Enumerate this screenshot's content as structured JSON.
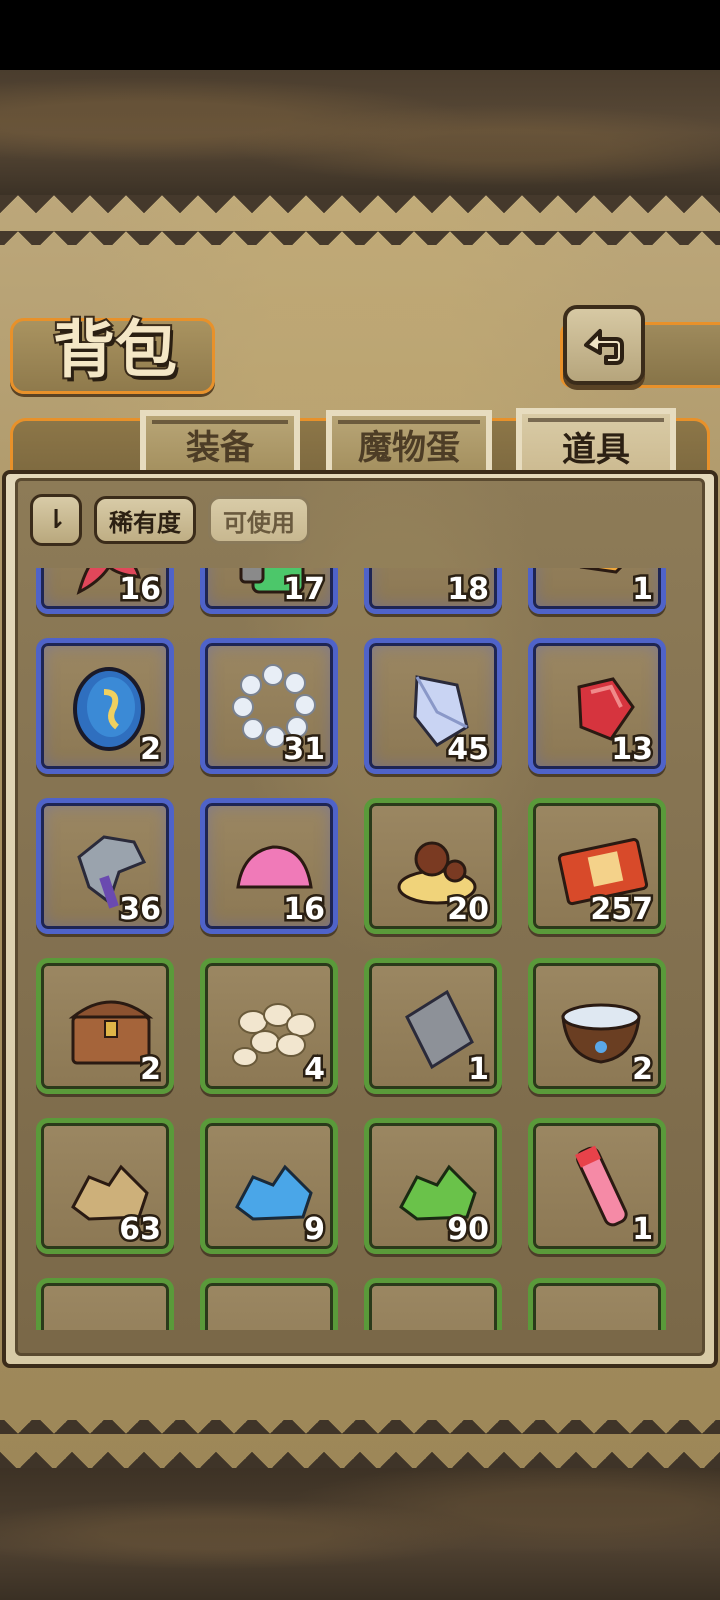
{
  "header": {
    "title": "背包",
    "back_icon": "back-arrow-icon"
  },
  "tabs": [
    {
      "label": "装备",
      "active": false
    },
    {
      "label": "魔物蛋",
      "active": false
    },
    {
      "label": "道具",
      "active": true
    }
  ],
  "filters": {
    "sort_icon": "sort-toggle-icon",
    "sort_label": "⇂",
    "chips": [
      {
        "label": "稀有度",
        "active": true
      },
      {
        "label": "可使用",
        "active": false
      }
    ]
  },
  "colors": {
    "rare_border": "#4f63c9",
    "common_border": "#5a9a3a",
    "accent_orange": "#e8912a"
  },
  "items": [
    {
      "name": "red-coral",
      "icon": "coral-icon",
      "count": "16",
      "rarity": "rare"
    },
    {
      "name": "green-battery",
      "icon": "battery-icon",
      "count": "17",
      "rarity": "rare"
    },
    {
      "name": "pink-orb",
      "icon": "pink-orb-icon",
      "count": "18",
      "rarity": "rare"
    },
    {
      "name": "gold-ore",
      "icon": "gold-ore-icon",
      "count": "1",
      "rarity": "rare"
    },
    {
      "name": "rune-coin",
      "icon": "coin-icon",
      "count": "2",
      "rarity": "rare"
    },
    {
      "name": "pearl-necklace",
      "icon": "pearl-ring-icon",
      "count": "31",
      "rarity": "rare"
    },
    {
      "name": "crystal-shard",
      "icon": "crystal-icon",
      "count": "45",
      "rarity": "rare"
    },
    {
      "name": "ruby-gem",
      "icon": "ruby-icon",
      "count": "13",
      "rarity": "rare"
    },
    {
      "name": "armor-scrap",
      "icon": "armor-scrap-icon",
      "count": "36",
      "rarity": "rare"
    },
    {
      "name": "pink-slime",
      "icon": "slime-icon",
      "count": "16",
      "rarity": "rare"
    },
    {
      "name": "pudding",
      "icon": "pudding-icon",
      "count": "20",
      "rarity": "common"
    },
    {
      "name": "ticket",
      "icon": "ticket-icon",
      "count": "257",
      "rarity": "common"
    },
    {
      "name": "treasure-chest",
      "icon": "chest-icon",
      "count": "2",
      "rarity": "common"
    },
    {
      "name": "eggs",
      "icon": "eggs-icon",
      "count": "4",
      "rarity": "common"
    },
    {
      "name": "iron-bar",
      "icon": "iron-bar-icon",
      "count": "1",
      "rarity": "common"
    },
    {
      "name": "water-bowl",
      "icon": "bowl-icon",
      "count": "2",
      "rarity": "common"
    },
    {
      "name": "sand-ore",
      "icon": "sand-ore-icon",
      "count": "63",
      "rarity": "common"
    },
    {
      "name": "blue-ore",
      "icon": "blue-ore-icon",
      "count": "9",
      "rarity": "common"
    },
    {
      "name": "green-ore",
      "icon": "green-ore-icon",
      "count": "90",
      "rarity": "common"
    },
    {
      "name": "potion-vial",
      "icon": "potion-icon",
      "count": "1",
      "rarity": "common"
    },
    {
      "name": "partial-1",
      "icon": "",
      "count": "",
      "rarity": "common"
    },
    {
      "name": "partial-2",
      "icon": "",
      "count": "",
      "rarity": "common"
    },
    {
      "name": "partial-3",
      "icon": "",
      "count": "",
      "rarity": "common"
    },
    {
      "name": "partial-4",
      "icon": "",
      "count": "",
      "rarity": "common"
    }
  ]
}
